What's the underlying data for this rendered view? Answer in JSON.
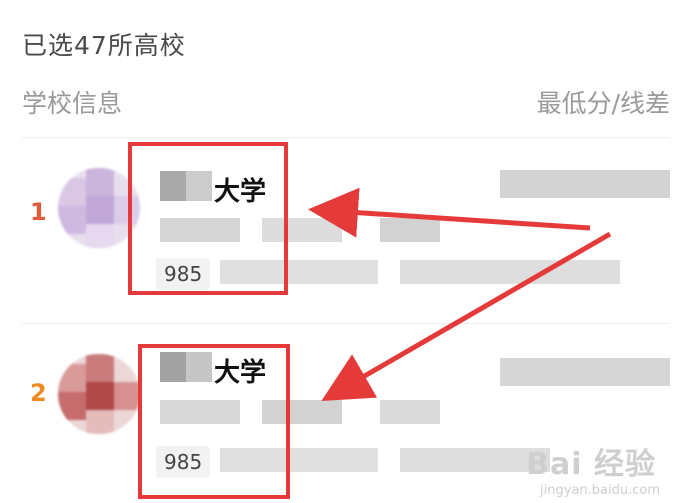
{
  "header": {
    "selected_count": "已选47所高校"
  },
  "columns": {
    "left": "学校信息",
    "right": "最低分/线差"
  },
  "items": [
    {
      "rank": "1",
      "name_visible": "大学",
      "tag": "985",
      "rank_color": "#e05a3c"
    },
    {
      "rank": "2",
      "name_visible": "大学",
      "tag": "985",
      "rank_color": "#ef8a22"
    }
  ],
  "watermark": {
    "main": "Bai 经验",
    "sub": "jingyan.baidu.com"
  },
  "colors": {
    "highlight": "#e53a3a",
    "arrow": "#e53a3a"
  }
}
